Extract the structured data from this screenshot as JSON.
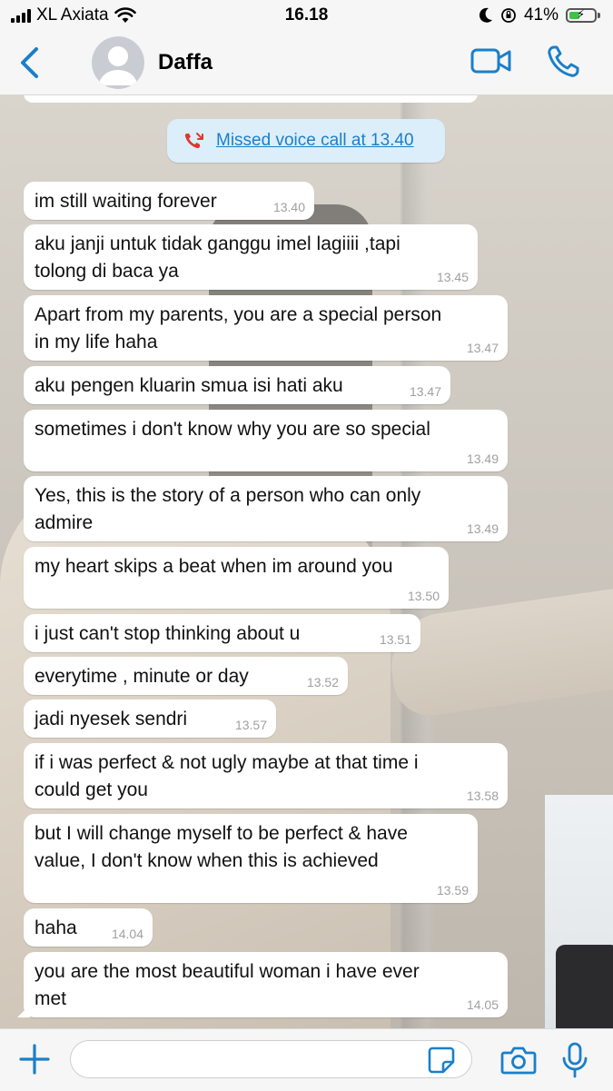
{
  "status_bar": {
    "carrier": "XL Axiata",
    "time": "16.18",
    "battery": "41%",
    "battery_level": 0.41,
    "battery_color": "#3cc24a"
  },
  "header": {
    "contact_name": "Daffa",
    "back_icon": "chevron-left-icon",
    "video_icon": "video-camera-icon",
    "call_icon": "phone-icon",
    "accent_color": "#1b7fc9"
  },
  "missed_call": {
    "text": "Missed voice call at 13.40",
    "icon": "missed-call-icon",
    "icon_color": "#e0362d"
  },
  "messages": [
    {
      "text": "im still waiting forever",
      "time": "13.40"
    },
    {
      "text": "aku janji untuk tidak ganggu imel lagiiii ,tapi\ntolong di baca ya",
      "time": "13.45"
    },
    {
      "text": "Apart from my parents, you are a special person\nin my life haha",
      "time": "13.47"
    },
    {
      "text": "aku pengen kluarin smua isi hati aku",
      "time": "13.47"
    },
    {
      "text": "sometimes i don't know why you are so special",
      "time": "13.49"
    },
    {
      "text": "Yes, this is the story of a person who can only\nadmire",
      "time": "13.49"
    },
    {
      "text": "my heart skips a beat when im around you",
      "time": "13.50"
    },
    {
      "text": "i just can't stop thinking about u",
      "time": "13.51"
    },
    {
      "text": "everytime , minute or day",
      "time": "13.52"
    },
    {
      "text": "jadi nyesek sendri",
      "time": "13.57"
    },
    {
      "text": "if i was perfect & not ugly maybe at that time i\ncould get you",
      "time": "13.58"
    },
    {
      "text": "but I will change myself to be perfect & have\nvalue, I don't know when this is achieved",
      "time": "13.59"
    },
    {
      "text": "haha",
      "time": "14.04"
    },
    {
      "text": "you are the most beautiful woman i have ever\nmet",
      "time": "14.05"
    }
  ],
  "input_bar": {
    "plus_icon": "plus-icon",
    "placeholder": "",
    "sticker_icon": "sticker-icon",
    "camera_icon": "camera-icon",
    "mic_icon": "microphone-icon"
  }
}
